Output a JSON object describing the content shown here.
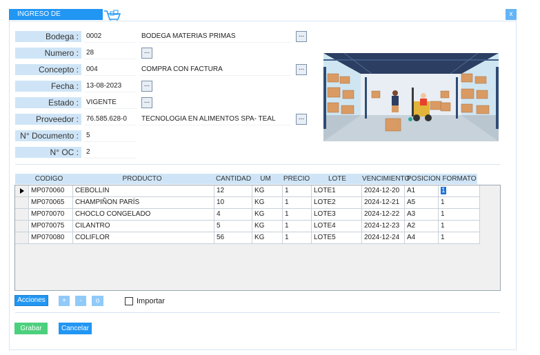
{
  "window": {
    "title": "INGRESO DE MATERIALES",
    "close_label": "x"
  },
  "header": {
    "bodega": {
      "label": "Bodega :",
      "code": "0002",
      "desc": "BODEGA MATERIAS PRIMAS"
    },
    "numero": {
      "label": "Numero :",
      "value": "28"
    },
    "concepto": {
      "label": "Concepto :",
      "code": "004",
      "desc": "COMPRA CON FACTURA"
    },
    "fecha": {
      "label": "Fecha :",
      "value": "13-08-2023"
    },
    "estado": {
      "label": "Estado :",
      "value": "VIGENTE"
    },
    "proveedor": {
      "label": "Proveedor :",
      "code": "76.585.628-0",
      "desc": "TECNOLOGIA EN ALIMENTOS SPA- TEAL"
    },
    "documento": {
      "label": "N° Documento :",
      "value": "5"
    },
    "oc": {
      "label": "N° OC :",
      "value": "2"
    },
    "lookup_label": "..."
  },
  "grid": {
    "columns": [
      "CODIGO",
      "PRODUCTO",
      "CANTIDAD",
      "UM",
      "PRECIO",
      "LOTE",
      "VENCIMIENTO",
      "POSICION",
      "FORMATO"
    ],
    "rows": [
      {
        "codigo": "MP070060",
        "producto": "CEBOLLIN",
        "cantidad": "12",
        "um": "KG",
        "precio": "1",
        "lote": "LOTE1",
        "vencimiento": "2024-12-20",
        "posicion": "A1",
        "formato": "1"
      },
      {
        "codigo": "MP070065",
        "producto": "CHAMPIÑON PARÍS",
        "cantidad": "10",
        "um": "KG",
        "precio": "1",
        "lote": "LOTE2",
        "vencimiento": "2024-12-21",
        "posicion": "A5",
        "formato": "1"
      },
      {
        "codigo": "MP070070",
        "producto": "CHOCLO CONGELADO",
        "cantidad": "4",
        "um": "KG",
        "precio": "1",
        "lote": "LOTE3",
        "vencimiento": "2024-12-22",
        "posicion": "A3",
        "formato": "1"
      },
      {
        "codigo": "MP070075",
        "producto": "CILANTRO",
        "cantidad": "5",
        "um": "KG",
        "precio": "1",
        "lote": "LOTE4",
        "vencimiento": "2024-12-23",
        "posicion": "A2",
        "formato": "1"
      },
      {
        "codigo": "MP070080",
        "producto": "COLIFLOR",
        "cantidad": "56",
        "um": "KG",
        "precio": "1",
        "lote": "LOTE5",
        "vencimiento": "2024-12-24",
        "posicion": "A4",
        "formato": "1"
      }
    ]
  },
  "actions": {
    "acciones_label": "Acciones",
    "add_label": "+",
    "remove_label": "-",
    "other_label": "o",
    "importar_label": "Importar"
  },
  "footer": {
    "grabar_label": "Grabar",
    "cancelar_label": "Cancelar"
  },
  "colors": {
    "accent": "#2196f3",
    "label_bg": "#cfe5f7",
    "grabar": "#4cd07d"
  },
  "icons": [
    "cart-icon",
    "row-pointer-icon",
    "warehouse-illustration"
  ]
}
